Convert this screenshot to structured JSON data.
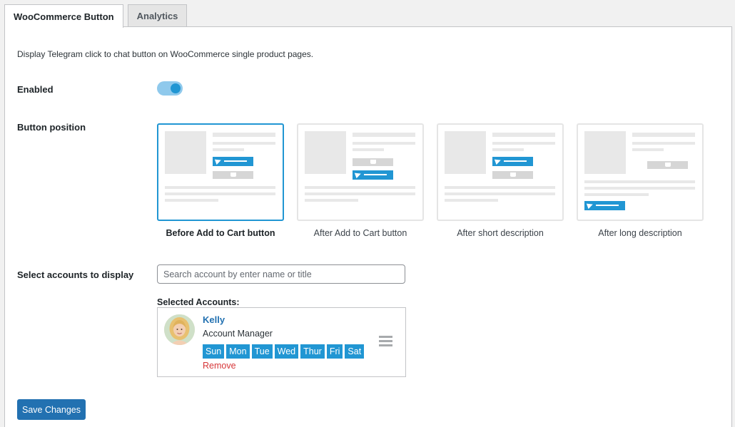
{
  "tabs": [
    {
      "label": "WooCommerce Button",
      "active": true
    },
    {
      "label": "Analytics",
      "active": false
    }
  ],
  "description": "Display Telegram click to chat button on WooCommerce single product pages.",
  "enabled": {
    "label": "Enabled",
    "value": true
  },
  "button_position": {
    "label": "Button position",
    "selected_index": 0,
    "options": [
      {
        "label": "Before Add to Cart button"
      },
      {
        "label": "After Add to Cart button"
      },
      {
        "label": "After short description"
      },
      {
        "label": "After long description"
      }
    ]
  },
  "accounts": {
    "label": "Select accounts to display",
    "search_placeholder": "Search account by enter name or title",
    "selected_title": "Selected Accounts:",
    "selected": [
      {
        "name": "Kelly",
        "title": "Account Manager",
        "days": [
          "Sun",
          "Mon",
          "Tue",
          "Wed",
          "Thur",
          "Fri",
          "Sat"
        ],
        "remove_label": "Remove"
      }
    ]
  },
  "save_label": "Save Changes",
  "colors": {
    "accent": "#2196d3",
    "link": "#2271b1",
    "danger": "#d63638"
  }
}
